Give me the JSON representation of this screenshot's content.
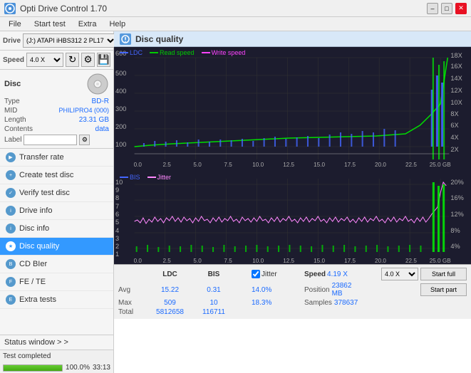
{
  "titleBar": {
    "appName": "Opti Drive Control 1.70",
    "iconLabel": "O",
    "minLabel": "–",
    "maxLabel": "□",
    "closeLabel": "✕"
  },
  "menuBar": {
    "items": [
      "File",
      "Start test",
      "Extra",
      "Help"
    ]
  },
  "drive": {
    "label": "Drive",
    "dropdownValue": "(J:) ATAPI iHBS312  2 PL17",
    "speedLabel": "Speed",
    "speedValue": "4.0 X",
    "ejectIcon": "⏏"
  },
  "disc": {
    "sectionLabel": "Disc",
    "type": "BD-R",
    "mid": "PHILIPRO4 (000)",
    "length": "23.31 GB",
    "contents": "data",
    "labelKey": "Label",
    "labelPlaceholder": ""
  },
  "nav": {
    "items": [
      {
        "id": "transfer-rate",
        "label": "Transfer rate",
        "active": false
      },
      {
        "id": "create-test-disc",
        "label": "Create test disc",
        "active": false
      },
      {
        "id": "verify-test-disc",
        "label": "Verify test disc",
        "active": false
      },
      {
        "id": "drive-info",
        "label": "Drive info",
        "active": false
      },
      {
        "id": "disc-info",
        "label": "Disc info",
        "active": false
      },
      {
        "id": "disc-quality",
        "label": "Disc quality",
        "active": true
      },
      {
        "id": "cd-bier",
        "label": "CD BIer",
        "active": false
      },
      {
        "id": "fe-te",
        "label": "FE / TE",
        "active": false
      },
      {
        "id": "extra-tests",
        "label": "Extra tests",
        "active": false
      }
    ]
  },
  "statusWindow": {
    "label": "Status window > >"
  },
  "statusBar": {
    "statusText": "Test completed",
    "progressPercent": 100,
    "progressLabel": "100.0%",
    "timeLabel": "33:13"
  },
  "discQuality": {
    "title": "Disc quality",
    "chart1": {
      "legend": [
        {
          "color": "#0000ff",
          "label": "LDC"
        },
        {
          "color": "#00cc00",
          "label": "Read speed"
        },
        {
          "color": "#ff00ff",
          "label": "Write speed"
        }
      ],
      "yAxisMax": 600,
      "yAxisLabels": [
        "600",
        "500",
        "400",
        "300",
        "200",
        "100",
        "0"
      ],
      "yAxisRight": [
        "18X",
        "16X",
        "14X",
        "12X",
        "10X",
        "8X",
        "6X",
        "4X",
        "2X"
      ],
      "xAxisLabels": [
        "0.0",
        "2.5",
        "5.0",
        "7.5",
        "10.0",
        "12.5",
        "15.0",
        "17.5",
        "20.0",
        "22.5",
        "25.0 GB"
      ]
    },
    "chart2": {
      "legend": [
        {
          "color": "#0000ff",
          "label": "BIS"
        },
        {
          "color": "#ff88ff",
          "label": "Jitter"
        }
      ],
      "yAxisLeft": [
        "10",
        "9",
        "8",
        "7",
        "6",
        "5",
        "4",
        "3",
        "2",
        "1"
      ],
      "yAxisRight": [
        "20%",
        "16%",
        "12%",
        "8%",
        "4%"
      ],
      "xAxisLabels": [
        "0.0",
        "2.5",
        "5.0",
        "7.5",
        "10.0",
        "12.5",
        "15.0",
        "17.5",
        "20.0",
        "22.5",
        "25.0 GB"
      ]
    },
    "stats": {
      "columns": [
        "LDC",
        "BIS",
        "",
        "Jitter",
        "Speed",
        ""
      ],
      "avgLabel": "Avg",
      "maxLabel": "Max",
      "totalLabel": "Total",
      "avgLDC": "15.22",
      "avgBIS": "0.31",
      "avgJitter": "14.0%",
      "avgSpeed": "4.19 X",
      "maxLDC": "509",
      "maxBIS": "10",
      "maxJitter": "18.3%",
      "totalLDC": "5812658",
      "totalBIS": "116711",
      "positionLabel": "Position",
      "positionValue": "23862 MB",
      "samplesLabel": "Samples",
      "samplesValue": "378637",
      "speedDropdown": "4.0 X",
      "startFullLabel": "Start full",
      "startPartLabel": "Start part",
      "jitterChecked": true,
      "jitterLabel": "Jitter"
    }
  }
}
